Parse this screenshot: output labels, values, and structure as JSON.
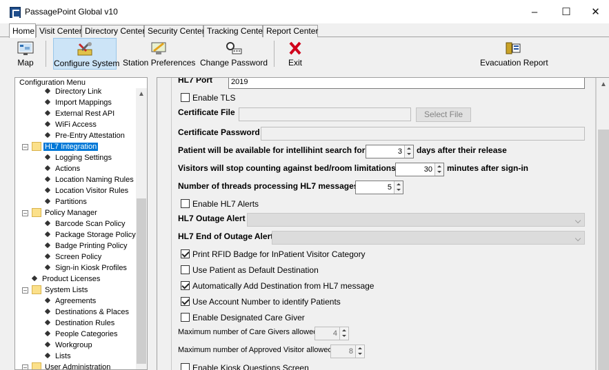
{
  "window": {
    "title": "PassagePoint Global v10",
    "minimize": "–",
    "maximize": "☐",
    "close": "✕"
  },
  "tabs": [
    "Home",
    "Visit Center",
    "Directory Center",
    "Security Center",
    "Tracking Center",
    "Report Center"
  ],
  "toolbar": {
    "map": "Map",
    "configure_system": "Configure System",
    "station_preferences": "Station Preferences",
    "change_password": "Change Password",
    "exit": "Exit",
    "evacuation_report": "Evacuation Report"
  },
  "config_menu": {
    "title": "Configuration Menu",
    "items": [
      "Directory Link",
      "Import Mappings",
      "External Rest API",
      "WiFi Access",
      "Pre-Entry Attestation",
      "HL7 Integration",
      "Logging Settings",
      "Actions",
      "Location Naming Rules",
      "Location Visitor Rules",
      "Partitions",
      "Policy Manager",
      "Barcode Scan Policy",
      "Package Storage Policy",
      "Badge Printing Policy",
      "Screen Policy",
      "Sign-in Kiosk Profiles",
      "Product Licenses",
      "System Lists",
      "Agreements",
      "Destinations & Places",
      "Destination Rules",
      "People Categories",
      "Workgroup",
      "Lists",
      "User Administration"
    ]
  },
  "form": {
    "hl7_port_label": "HL7 Port",
    "hl7_port_value": "2019",
    "enable_tls": "Enable TLS",
    "certificate_file_label": "Certificate File",
    "certificate_file_value": "",
    "select_file": "Select File",
    "certificate_password_label": "Certificate Password",
    "patient_search_label": "Patient will be available for intellihint search for",
    "patient_search_value": "3",
    "patient_search_suffix": "days after their release",
    "visitors_stop_label": "Visitors will stop counting against bed/room limitations",
    "visitors_stop_value": "30",
    "visitors_stop_suffix": "minutes after sign-in",
    "threads_label": "Number of threads processing HL7 messages",
    "threads_value": "5",
    "enable_alerts": "Enable HL7 Alerts",
    "outage_alert_label": "HL7 Outage Alert",
    "end_outage_alert_label": "HL7 End of Outage Alert",
    "print_rfid": "Print RFID Badge for InPatient Visitor Category",
    "use_patient_default": "Use Patient as Default Destination",
    "auto_add_destination": "Automatically Add Destination from HL7 message",
    "use_account_number": "Use Account Number to identify Patients",
    "enable_designated": "Enable Designated Care Giver",
    "max_care_givers_label": "Maximum number of Care Givers allowed",
    "max_care_givers_value": "4",
    "max_approved_label": "Maximum number of Approved Visitor allowed",
    "max_approved_value": "8",
    "enable_kiosk_questions": "Enable Kiosk Questions Screen"
  },
  "colors": {
    "selection": "#0078d7",
    "toolbar_selected": "#cce4f7"
  }
}
